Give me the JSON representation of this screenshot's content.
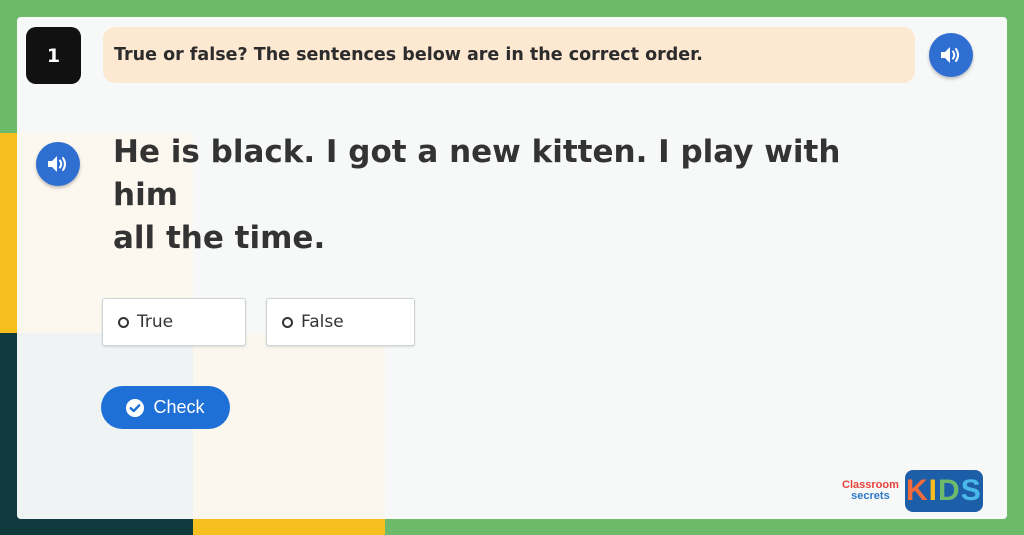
{
  "question": {
    "number": "1",
    "instruction": "True or false? The sentences below are in the correct order.",
    "sentence_line1": "He is black. I got a new kitten. I play with him",
    "sentence_line2": "all the time."
  },
  "options": [
    {
      "label": "True"
    },
    {
      "label": "False"
    }
  ],
  "check_button": {
    "label": "Check",
    "icon": "check-circle-icon"
  },
  "audio_icons": [
    "speaker-icon",
    "speaker-icon"
  ],
  "logo": {
    "line1": "Classroom",
    "line2": "secrets",
    "kids": [
      "K",
      "I",
      "D",
      "S"
    ]
  },
  "colors": {
    "accent_blue": "#1f70d6",
    "frame_green": "#6dba6b",
    "instruction_bg": "#fde8d2",
    "yellow": "#f6bf1e",
    "dark_teal": "#113a3e"
  }
}
